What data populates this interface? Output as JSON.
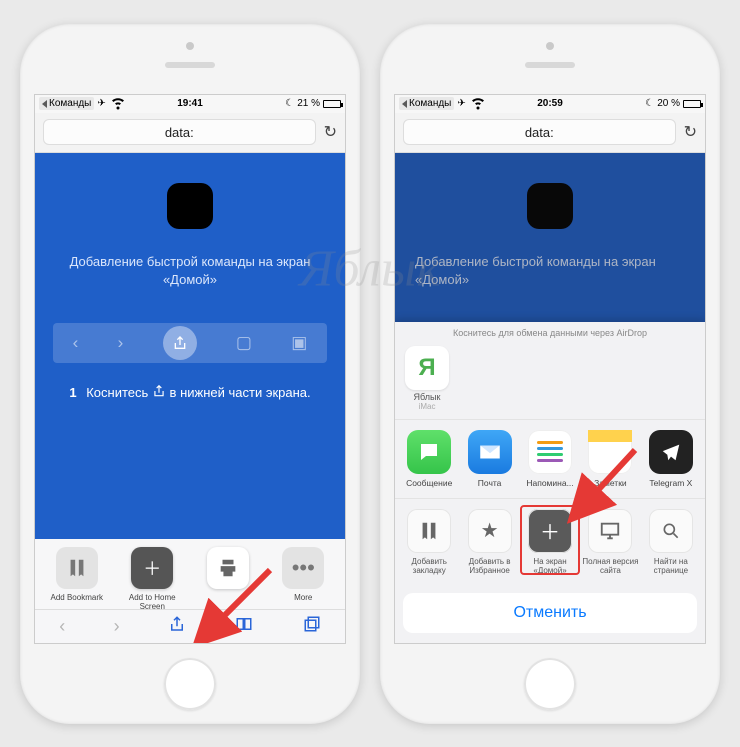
{
  "watermark": "Яблык",
  "left": {
    "status": {
      "back": "Команды",
      "time": "19:41",
      "battery_pct": "21 %"
    },
    "url": "data:",
    "headline": "Добавление быстрой команды на экран «Домой»",
    "step_num": "1",
    "step_a": "Коснитесь",
    "step_b": "в нижней части экрана.",
    "mini_sheet": {
      "bookmark": "Add Bookmark",
      "home": "Add to Home Screen",
      "more": "More"
    }
  },
  "right": {
    "status": {
      "back": "Команды",
      "time": "20:59",
      "battery_pct": "20 %"
    },
    "url": "data:",
    "headline": "Добавление быстрой команды на экран «Домой»",
    "sheet": {
      "hint": "Коснитесь для обмена данными через AirDrop",
      "airdrop": {
        "name": "Яблык",
        "sub": "iMac"
      },
      "apps": {
        "message": "Сообщение",
        "mail": "Почта",
        "reminders": "Напомина...",
        "notes": "Заметки",
        "telegram": "Telegram X"
      },
      "actions": {
        "bookmark": "Добавить закладку",
        "favorites": "Добавить в Избранное",
        "homescreen": "На экран «Домой»",
        "desktop": "Полная версия сайта",
        "find": "Найти на странице"
      },
      "cancel": "Отменить"
    }
  }
}
